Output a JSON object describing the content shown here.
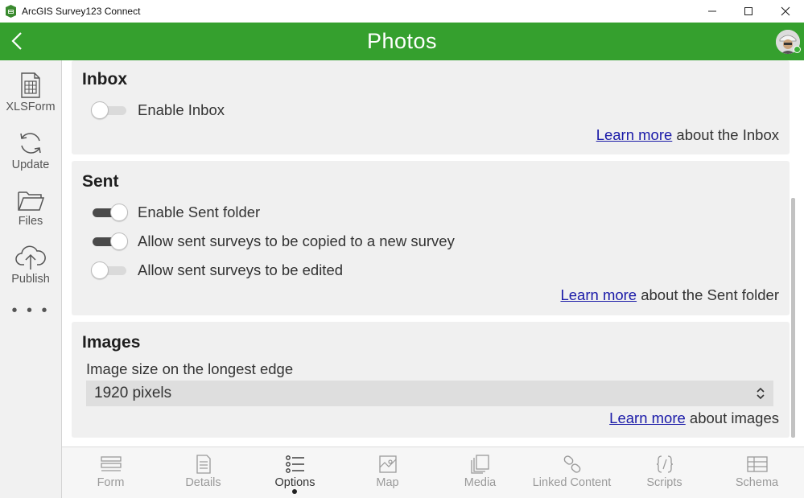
{
  "window": {
    "title": "ArcGIS Survey123 Connect"
  },
  "header": {
    "title": "Photos"
  },
  "sidebar": {
    "items": [
      {
        "label": "XLSForm",
        "icon": "spreadsheet-icon"
      },
      {
        "label": "Update",
        "icon": "refresh-icon"
      },
      {
        "label": "Files",
        "icon": "folder-icon"
      },
      {
        "label": "Publish",
        "icon": "cloud-upload-icon"
      }
    ],
    "more": "• • •"
  },
  "inbox": {
    "title": "Inbox",
    "toggles": [
      {
        "label": "Enable Inbox",
        "on": false
      }
    ],
    "learn_link": "Learn more",
    "learn_suffix": " about the Inbox"
  },
  "sent": {
    "title": "Sent",
    "toggles": [
      {
        "label": "Enable Sent folder",
        "on": true
      },
      {
        "label": "Allow sent surveys to be copied to a new survey",
        "on": true
      },
      {
        "label": "Allow sent surveys to be edited",
        "on": false
      }
    ],
    "learn_link": "Learn more",
    "learn_suffix": " about the Sent folder"
  },
  "images": {
    "title": "Images",
    "field_label": "Image size on the longest edge",
    "selected": "1920 pixels",
    "learn_link": "Learn more",
    "learn_suffix": " about images"
  },
  "tabs": [
    {
      "label": "Form",
      "icon": "form-icon",
      "active": false
    },
    {
      "label": "Details",
      "icon": "details-icon",
      "active": false
    },
    {
      "label": "Options",
      "icon": "options-list-icon",
      "active": true
    },
    {
      "label": "Map",
      "icon": "map-icon",
      "active": false
    },
    {
      "label": "Media",
      "icon": "media-icon",
      "active": false
    },
    {
      "label": "Linked Content",
      "icon": "link-icon",
      "active": false
    },
    {
      "label": "Scripts",
      "icon": "scripts-icon",
      "active": false
    },
    {
      "label": "Schema",
      "icon": "schema-icon",
      "active": false
    }
  ],
  "colors": {
    "header_green": "#35a02e",
    "link_blue": "#1a1aa8",
    "toggle_on": "#4a4a4a"
  }
}
